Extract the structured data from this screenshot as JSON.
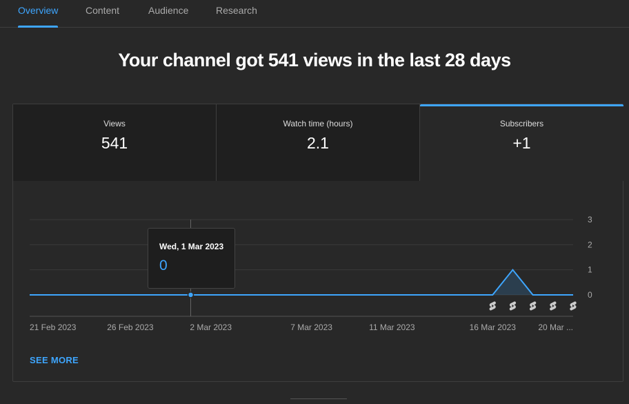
{
  "tabs": [
    {
      "label": "Overview",
      "active": true
    },
    {
      "label": "Content",
      "active": false
    },
    {
      "label": "Audience",
      "active": false
    },
    {
      "label": "Research",
      "active": false
    }
  ],
  "headline": "Your channel got 541 views in the last 28 days",
  "metrics": [
    {
      "label": "Views",
      "value": "541"
    },
    {
      "label": "Watch time (hours)",
      "value": "2.1"
    },
    {
      "label": "Subscribers",
      "value": "+1",
      "selected": true
    }
  ],
  "tooltip": {
    "date": "Wed, 1 Mar 2023",
    "value": "0"
  },
  "see_more_label": "SEE MORE",
  "colors": {
    "accent": "#3ea6ff",
    "background": "#282828",
    "panel": "#1f1f1f"
  },
  "chart_data": {
    "type": "line",
    "series": [
      {
        "x": [
          "21 Feb",
          "22 Feb",
          "23 Feb",
          "24 Feb",
          "25 Feb",
          "26 Feb",
          "27 Feb",
          "28 Feb",
          "1 Mar",
          "2 Mar",
          "3 Mar",
          "4 Mar",
          "5 Mar",
          "6 Mar",
          "7 Mar",
          "8 Mar",
          "9 Mar",
          "10 Mar",
          "11 Mar",
          "12 Mar",
          "13 Mar",
          "14 Mar",
          "15 Mar",
          "16 Mar",
          "17 Mar",
          "18 Mar",
          "19 Mar",
          "20 Mar"
        ],
        "values": [
          0,
          0,
          0,
          0,
          0,
          0,
          0,
          0,
          0,
          0,
          0,
          0,
          0,
          0,
          0,
          0,
          0,
          0,
          0,
          0,
          0,
          0,
          0,
          0,
          1,
          0,
          0,
          0
        ]
      }
    ],
    "x_tick_labels": [
      "21 Feb 2023",
      "26 Feb 2023",
      "2 Mar 2023",
      "7 Mar 2023",
      "11 Mar 2023",
      "16 Mar 2023",
      "20 Mar ..."
    ],
    "y_ticks": [
      0,
      1,
      2,
      3
    ],
    "ylim": [
      0,
      3
    ],
    "highlighted_point": "1 Mar",
    "video_markers": [
      "16 Mar",
      "17 Mar",
      "18 Mar",
      "19 Mar",
      "20 Mar"
    ],
    "marker_icon": "shorts-icon",
    "grid": true
  }
}
